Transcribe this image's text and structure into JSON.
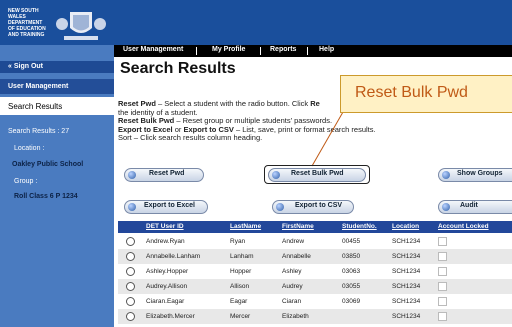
{
  "header": {
    "logo_text": "NEW SOUTH WALES\nDEPARTMENT\nOF EDUCATION\nAND TRAINING",
    "nav": [
      "User Management",
      "My Profile",
      "Reports",
      "Help"
    ]
  },
  "sidebar": {
    "sign_out": "« Sign Out",
    "user_management": "User Management",
    "search_results": "Search Results",
    "results_count": "Search Results : 27",
    "location_label": "Location :",
    "location_value": "Oakley Public School",
    "group_label": "Group :",
    "group_value": "Roll Class 6 P 1234"
  },
  "main": {
    "title": "Search Results",
    "instructions": {
      "l1a": "Reset Pwd",
      "l1b": " – Select a student with the radio button. Click ",
      "l1c": "Re",
      "l2": "the identity of a student.",
      "l3a": "Reset Bulk Pwd",
      "l3b": " – Reset group or multiple students' passwords.",
      "l4a": "Export to Excel",
      "l4b": " or ",
      "l4c": "Export to CSV",
      "l4d": " – List, save, print or format search results.",
      "l5": "Sort – Click search results column heading."
    },
    "buttons": {
      "reset_pwd": "Reset Pwd",
      "reset_bulk_pwd": "Reset Bulk Pwd",
      "show_groups": "Show Groups",
      "export_excel": "Export to Excel",
      "export_csv": "Export to CSV",
      "audit": "Audit"
    },
    "callout": "Reset Bulk Pwd"
  },
  "table": {
    "headers": [
      "DET User ID",
      "LastName",
      "FirstName",
      "StudentNo.",
      "Location",
      "Account Locked"
    ],
    "rows": [
      [
        "Andrew.Ryan",
        "Ryan",
        "Andrew",
        "00455",
        "SCH1234"
      ],
      [
        "Annabelle.Lanham",
        "Lanham",
        "Annabelle",
        "03850",
        "SCH1234"
      ],
      [
        "Ashley.Hopper",
        "Hopper",
        "Ashley",
        "03063",
        "SCH1234"
      ],
      [
        "Audrey.Allison",
        "Allison",
        "Audrey",
        "03055",
        "SCH1234"
      ],
      [
        "Ciaran.Eagar",
        "Eagar",
        "Ciaran",
        "03069",
        "SCH1234"
      ],
      [
        "Elizabeth.Mercer",
        "Mercer",
        "Elizabeth",
        "",
        "SCH1234"
      ]
    ]
  }
}
